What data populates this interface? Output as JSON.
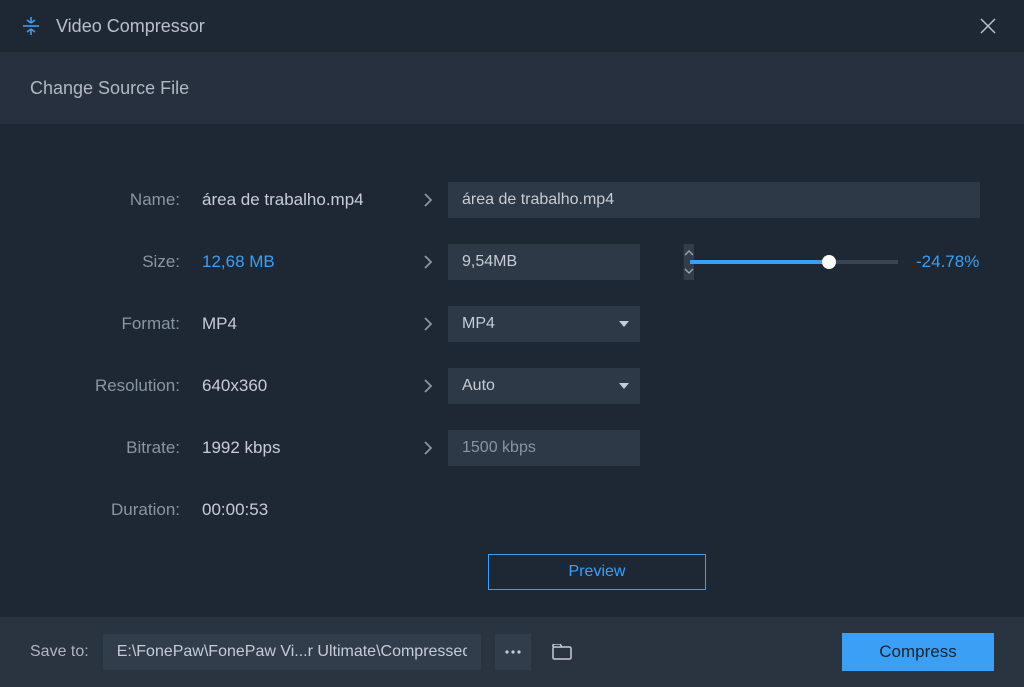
{
  "titlebar": {
    "title": "Video Compressor"
  },
  "subheader": {
    "change_source": "Change Source File"
  },
  "labels": {
    "name": "Name:",
    "size": "Size:",
    "format": "Format:",
    "resolution": "Resolution:",
    "bitrate": "Bitrate:",
    "duration": "Duration:"
  },
  "source": {
    "name": "área de trabalho.mp4",
    "size": "12,68 MB",
    "format": "MP4",
    "resolution": "640x360",
    "bitrate": "1992 kbps",
    "duration": "00:00:53"
  },
  "target": {
    "name": "área de trabalho.mp4",
    "size": "9,54MB",
    "format": "MP4",
    "resolution": "Auto",
    "bitrate": "1500 kbps",
    "percent": "-24.78%"
  },
  "preview_label": "Preview",
  "footer": {
    "save_to_label": "Save to:",
    "path": "E:\\FonePaw\\FonePaw Vi...r Ultimate\\Compressed",
    "compress_label": "Compress"
  },
  "colors": {
    "accent": "#3a9ff5"
  }
}
